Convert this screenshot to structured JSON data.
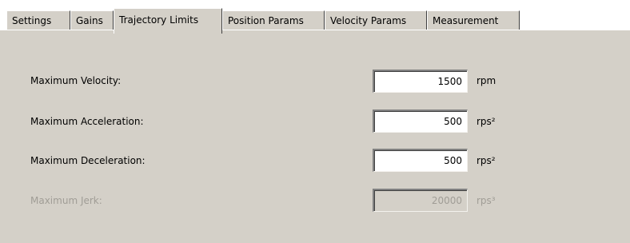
{
  "tabs": [
    {
      "label": "Settings",
      "active": false
    },
    {
      "label": "Gains",
      "active": false
    },
    {
      "label": "Trajectory Limits",
      "active": true
    },
    {
      "label": "Position Params",
      "active": false
    },
    {
      "label": "Velocity Params",
      "active": false
    },
    {
      "label": "Measurement",
      "active": false
    }
  ],
  "fields": [
    {
      "label": "Maximum Velocity:",
      "value": "1500",
      "unit": "rpm",
      "enabled": true
    },
    {
      "label": "Maximum Acceleration:",
      "value": "500",
      "unit": "rps²",
      "enabled": true
    },
    {
      "label": "Maximum Deceleration:",
      "value": "500",
      "unit": "rps²",
      "enabled": true
    },
    {
      "label": "Maximum Jerk:",
      "value": "20000",
      "unit": "rps³",
      "enabled": false
    }
  ],
  "colors": {
    "panel": "#d4d0c8",
    "disabled_text": "#a09d96",
    "field_background": "#ffffff"
  }
}
